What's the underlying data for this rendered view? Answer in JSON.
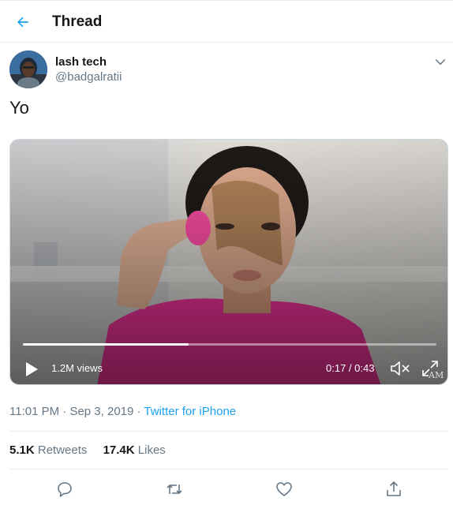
{
  "header": {
    "title": "Thread",
    "back_icon": "arrow-left-icon",
    "accent": "#1da1f2"
  },
  "tweet": {
    "author": {
      "display_name": "lash tech",
      "handle": "@badgalratii"
    },
    "text": "Yo",
    "media": {
      "views": "1.2M views",
      "time": "0:17 / 0:43",
      "progress": 0.4,
      "watermark": "AM"
    },
    "meta": {
      "time": "11:01 PM",
      "date": "Sep 3, 2019",
      "separator": "·",
      "source": "Twitter for iPhone"
    },
    "stats": {
      "retweets_count": "5.1K",
      "retweets_label": "Retweets",
      "likes_count": "17.4K",
      "likes_label": "Likes"
    }
  },
  "actions": [
    "reply-icon",
    "retweet-icon",
    "like-icon",
    "share-icon"
  ]
}
